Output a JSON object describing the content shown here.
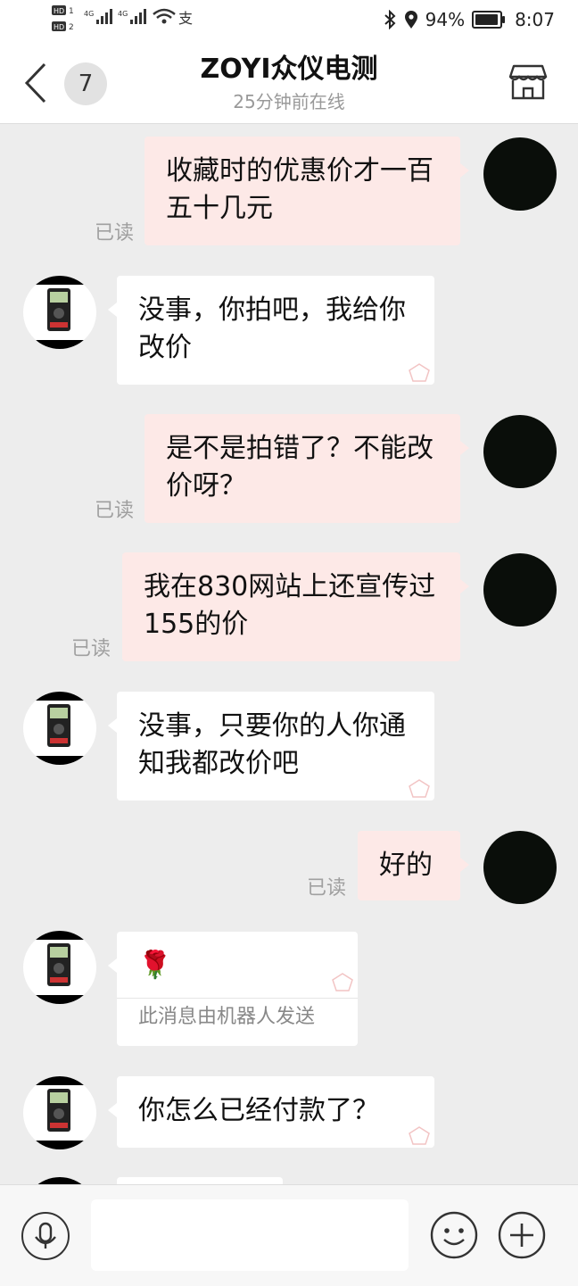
{
  "status_bar": {
    "network_left": "HD 4G 4G",
    "battery": "94%",
    "battery_level": 0.94,
    "time": "8:07"
  },
  "header": {
    "unread_count": "7",
    "title": "ZOYI众仪电测",
    "subtitle": "25分钟前在线"
  },
  "messages": [
    {
      "from": "me",
      "text": "收藏时的优惠价才一百五十几元",
      "read": "已读"
    },
    {
      "from": "shop",
      "text": "没事，你拍吧，我给你改价"
    },
    {
      "from": "me",
      "text": "是不是拍错了？不能改价呀？",
      "read": "已读"
    },
    {
      "from": "me",
      "text": "我在830网站上还宣传过155的价",
      "read": "已读"
    },
    {
      "from": "shop",
      "text": "没事，只要你的人你通知我都改价吧"
    },
    {
      "from": "me",
      "text": "好的",
      "read": "已读"
    },
    {
      "from": "shop",
      "emoji": "🌹",
      "note": "此消息由机器人发送"
    },
    {
      "from": "shop",
      "text": "你怎么已经付款了？"
    }
  ],
  "icons": {
    "back": "chevron-left-icon",
    "store": "store-icon",
    "mic": "microphone-icon",
    "emoji": "smiley-icon",
    "plus": "plus-icon"
  },
  "colors": {
    "my_bubble": "#fde9e7",
    "shop_bubble": "#ffffff",
    "chat_bg": "#ededed"
  }
}
